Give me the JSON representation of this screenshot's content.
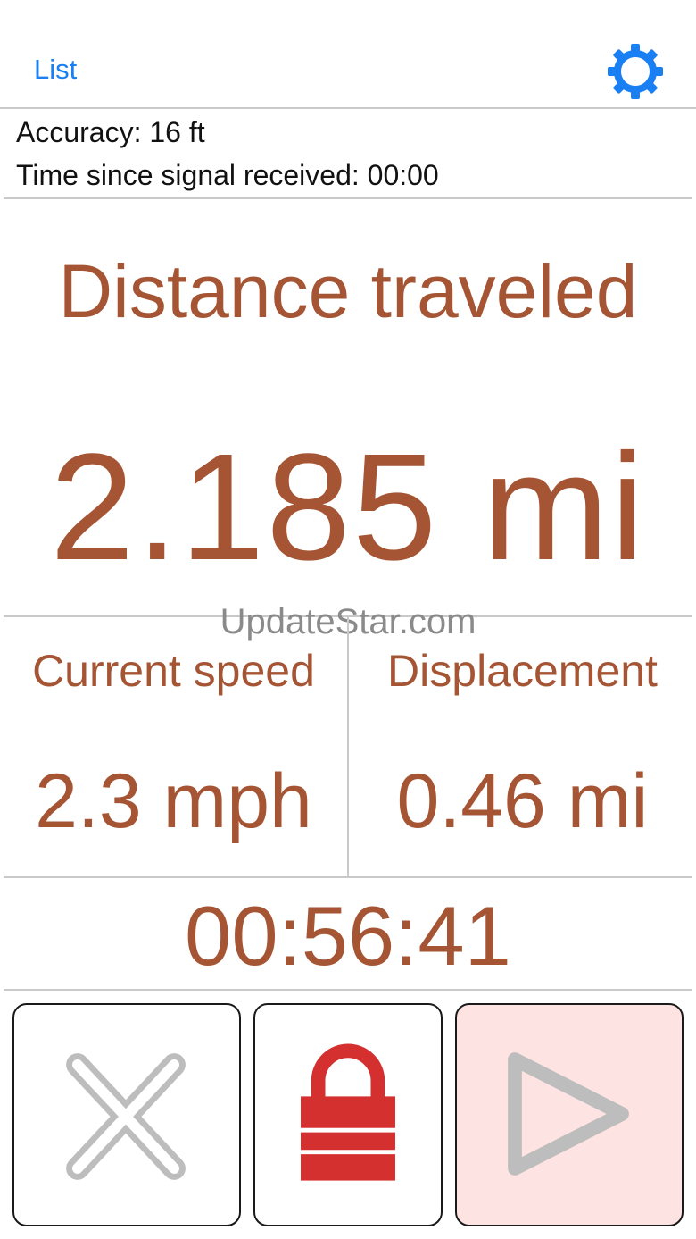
{
  "nav": {
    "list_label": "List",
    "settings_icon": "gear-icon"
  },
  "status": {
    "accuracy": "Accuracy: 16 ft",
    "time_since_signal": "Time since signal received: 00:00"
  },
  "distance": {
    "label": "Distance traveled",
    "value": "2.185 mi"
  },
  "watermark": "UpdateStar.com",
  "speed": {
    "label": "Current speed",
    "value": "2.3 mph"
  },
  "displacement": {
    "label": "Displacement",
    "value": "0.46 mi"
  },
  "elapsed": "00:56:41",
  "buttons": {
    "reset_icon": "close-icon",
    "lock_icon": "lock-icon",
    "play_icon": "play-icon"
  },
  "colors": {
    "accent_text": "#a55534",
    "link_blue": "#1a7ff2",
    "lock_red": "#d3302f",
    "play_bg": "#fde4e3"
  }
}
